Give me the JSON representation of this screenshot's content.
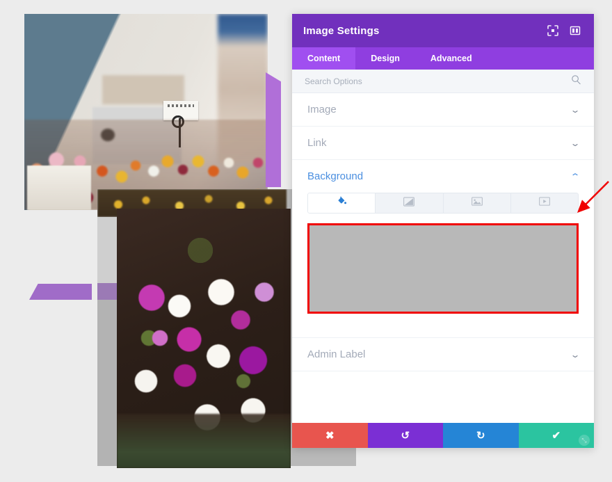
{
  "app": {
    "background_color": "#ececec"
  },
  "panel": {
    "title": "Image Settings",
    "header_icons": [
      {
        "name": "focus-target-icon",
        "glyph": "⦿"
      },
      {
        "name": "layout-columns-icon",
        "glyph": "▣"
      }
    ],
    "accent_header": "#7130bd",
    "accent_tabs": "#8f3ee0",
    "tabs": [
      {
        "label": "Content",
        "active": true
      },
      {
        "label": "Design",
        "active": false
      },
      {
        "label": "Advanced",
        "active": false
      }
    ],
    "search": {
      "placeholder": "Search Options",
      "value": "",
      "icon": "search-icon"
    },
    "sections": [
      {
        "label": "Image",
        "open": false,
        "chevron": "⌄"
      },
      {
        "label": "Link",
        "open": false,
        "chevron": "⌄"
      },
      {
        "label": "Background",
        "open": true,
        "chevron": "⌃"
      },
      {
        "label": "Admin Label",
        "open": false,
        "chevron": "⌄"
      }
    ],
    "background": {
      "type_tabs": [
        {
          "name": "background-color-tab",
          "icon": "paint-bucket-icon",
          "active": true
        },
        {
          "name": "background-gradient-tab",
          "icon": "gradient-icon",
          "active": false
        },
        {
          "name": "background-image-tab",
          "icon": "image-icon",
          "active": false
        },
        {
          "name": "background-video-tab",
          "icon": "video-icon",
          "active": false
        }
      ],
      "swatch": {
        "fill_color": "#b8b8b8",
        "highlight_border_color": "#f00000"
      }
    },
    "actions": [
      {
        "name": "cancel-button",
        "glyph": "✖",
        "color": "#e8554e"
      },
      {
        "name": "undo-button",
        "glyph": "↺",
        "color": "#7b2fd4"
      },
      {
        "name": "redo-button",
        "glyph": "↻",
        "color": "#2585d6"
      },
      {
        "name": "save-button",
        "glyph": "✔",
        "color": "#2bc4a0"
      }
    ],
    "drag_handle_glyph": "⤡"
  },
  "annotation": {
    "arrow_color": "#f00000",
    "points_to": "background-color-swatch"
  },
  "canvas": {
    "photos": [
      {
        "name": "flower-market-photo",
        "alt": "Blurred flower market stall with colorful blooms"
      },
      {
        "name": "grey-backdrop-photo",
        "alt": "Grey backdrop panel"
      },
      {
        "name": "bouquet-photo",
        "alt": "Close up bouquet of white and magenta cosmos flowers"
      }
    ],
    "accents": [
      {
        "name": "purple-accent-right",
        "color": "#b06fd8"
      },
      {
        "name": "purple-accent-bottom",
        "color": "#a06cc8"
      }
    ]
  }
}
